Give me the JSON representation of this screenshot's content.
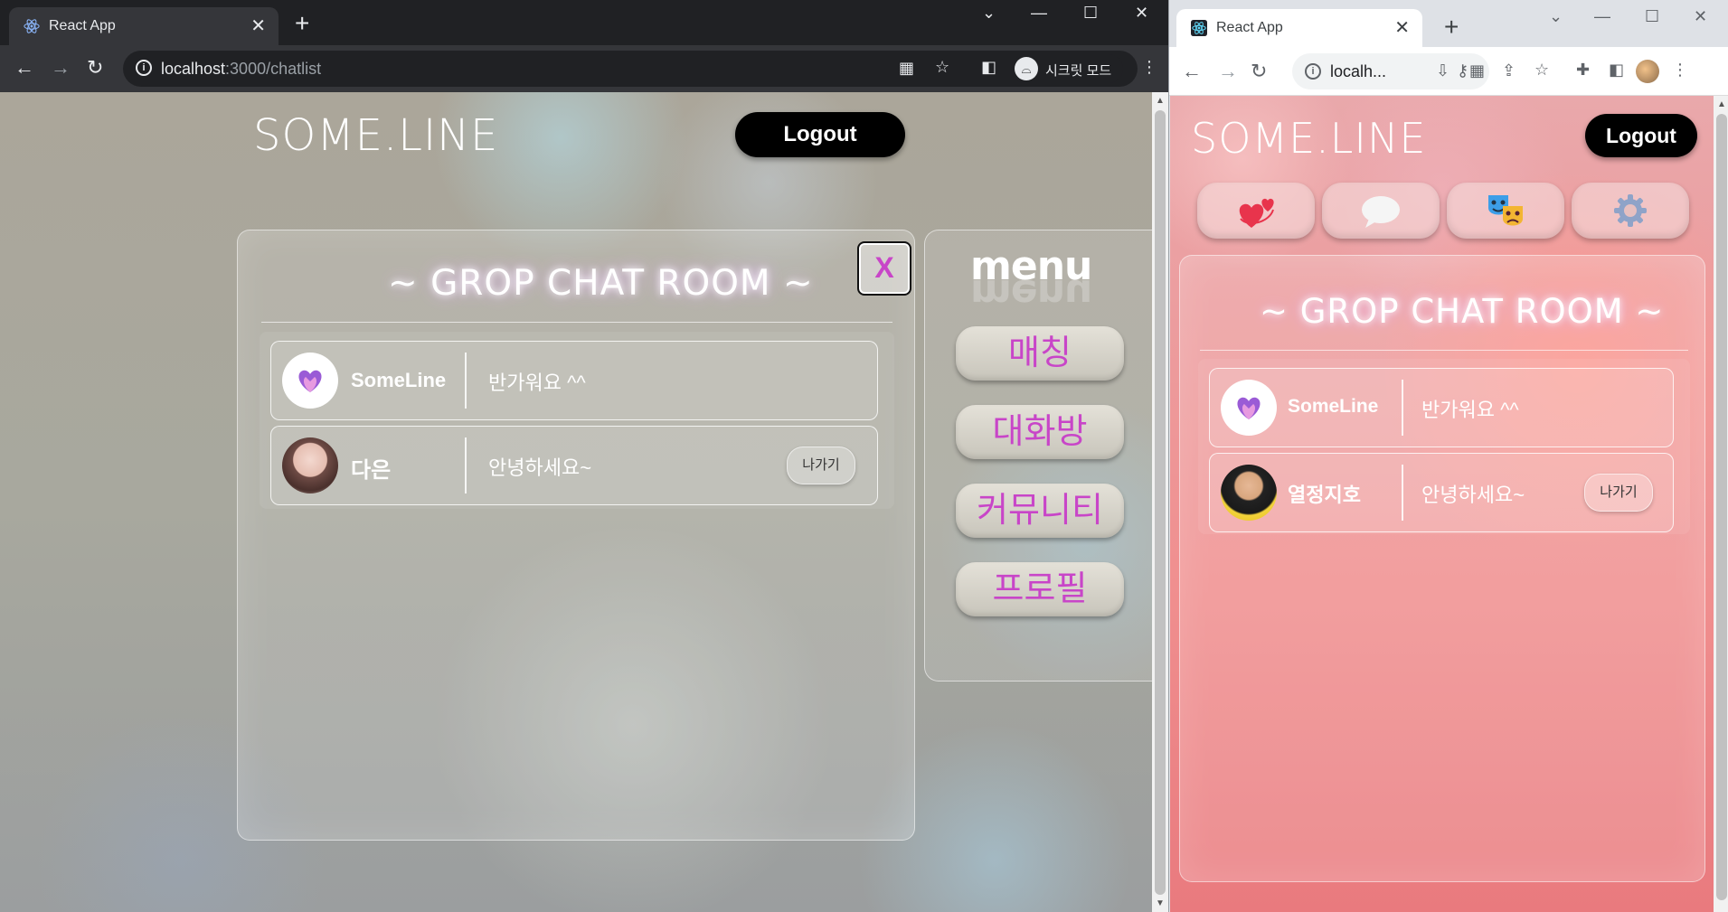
{
  "left_window": {
    "tab": {
      "title": "React App",
      "close": "✕"
    },
    "new_tab": "+",
    "window_controls": {
      "dropdown": "⌄",
      "minimize": "—",
      "maximize": "☐",
      "close": "✕"
    },
    "address": {
      "host": "localhost",
      "path": ":3000/chatlist"
    },
    "incognito_label": "시크릿 모드",
    "app": {
      "logo": "SOME.LINE",
      "logout": "Logout",
      "room_title": "~ GROP CHAT ROOM ~",
      "close_button": "X",
      "chats": [
        {
          "name": "SomeLine",
          "message": "반가워요 ^^"
        },
        {
          "name": "다은",
          "message": "안녕하세요~",
          "leave": "나가기"
        }
      ],
      "menu": {
        "title": "menu",
        "items": [
          "매칭",
          "대화방",
          "커뮤니티",
          "프로필"
        ]
      }
    }
  },
  "right_window": {
    "tab": {
      "title": "React App",
      "close": "✕"
    },
    "new_tab": "+",
    "address": {
      "text": "localh..."
    },
    "app": {
      "logo": "SOME.LINE",
      "logout": "Logout",
      "room_title": "~ GROP CHAT ROOM ~",
      "nav_icons": [
        "hearts-icon",
        "speech-bubble-icon",
        "theater-masks-icon",
        "gear-icon"
      ],
      "chats": [
        {
          "name": "SomeLine",
          "message": "반가워요 ^^"
        },
        {
          "name": "열정지호",
          "message": "안녕하세요~",
          "leave": "나가기"
        }
      ]
    }
  },
  "colors": {
    "accent": "#c845c8",
    "logout_bg": "#000000",
    "dark_chrome": "#35363a"
  }
}
